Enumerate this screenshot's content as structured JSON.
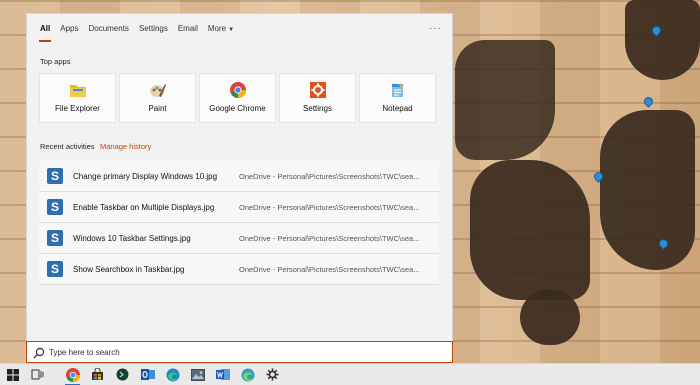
{
  "tabs": [
    {
      "label": "All",
      "active": true
    },
    {
      "label": "Apps"
    },
    {
      "label": "Documents"
    },
    {
      "label": "Settings"
    },
    {
      "label": "Email"
    },
    {
      "label": "More"
    }
  ],
  "more_options_label": "···",
  "top_apps": {
    "heading": "Top apps",
    "items": [
      {
        "label": "File Explorer",
        "icon": "folder-icon"
      },
      {
        "label": "Paint",
        "icon": "paint-icon"
      },
      {
        "label": "Google Chrome",
        "icon": "chrome-icon"
      },
      {
        "label": "Settings",
        "icon": "gear-icon"
      },
      {
        "label": "Notepad",
        "icon": "notepad-icon"
      }
    ]
  },
  "recent": {
    "heading": "Recent activities",
    "manage_label": "Manage history",
    "items": [
      {
        "name": "Change primary Display Windows 10.jpg",
        "path": "OneDrive - Personal\\Pictures\\Screenshots\\TWC\\sea..."
      },
      {
        "name": "Enable Taskbar on Multiple Displays.jpg",
        "path": "OneDrive - Personal\\Pictures\\Screenshots\\TWC\\sea..."
      },
      {
        "name": "Windows 10 Taskbar Settings.jpg",
        "path": "OneDrive - Personal\\Pictures\\Screenshots\\TWC\\sea..."
      },
      {
        "name": "Show Searchbox in Taskbar.jpg",
        "path": "OneDrive - Personal\\Pictures\\Screenshots\\TWC\\sea..."
      }
    ]
  },
  "search": {
    "placeholder": "Type here to search"
  },
  "taskbar": {
    "items": [
      "windows-start-icon",
      "task-view-icon",
      "chrome-icon",
      "store-icon",
      "terminal-icon",
      "outlook-icon",
      "edge-icon",
      "photos-icon",
      "word-icon",
      "edge-beta-icon",
      "settings-icon"
    ]
  },
  "colors": {
    "accent": "#c2410c",
    "file_icon": "#2f6fad"
  }
}
